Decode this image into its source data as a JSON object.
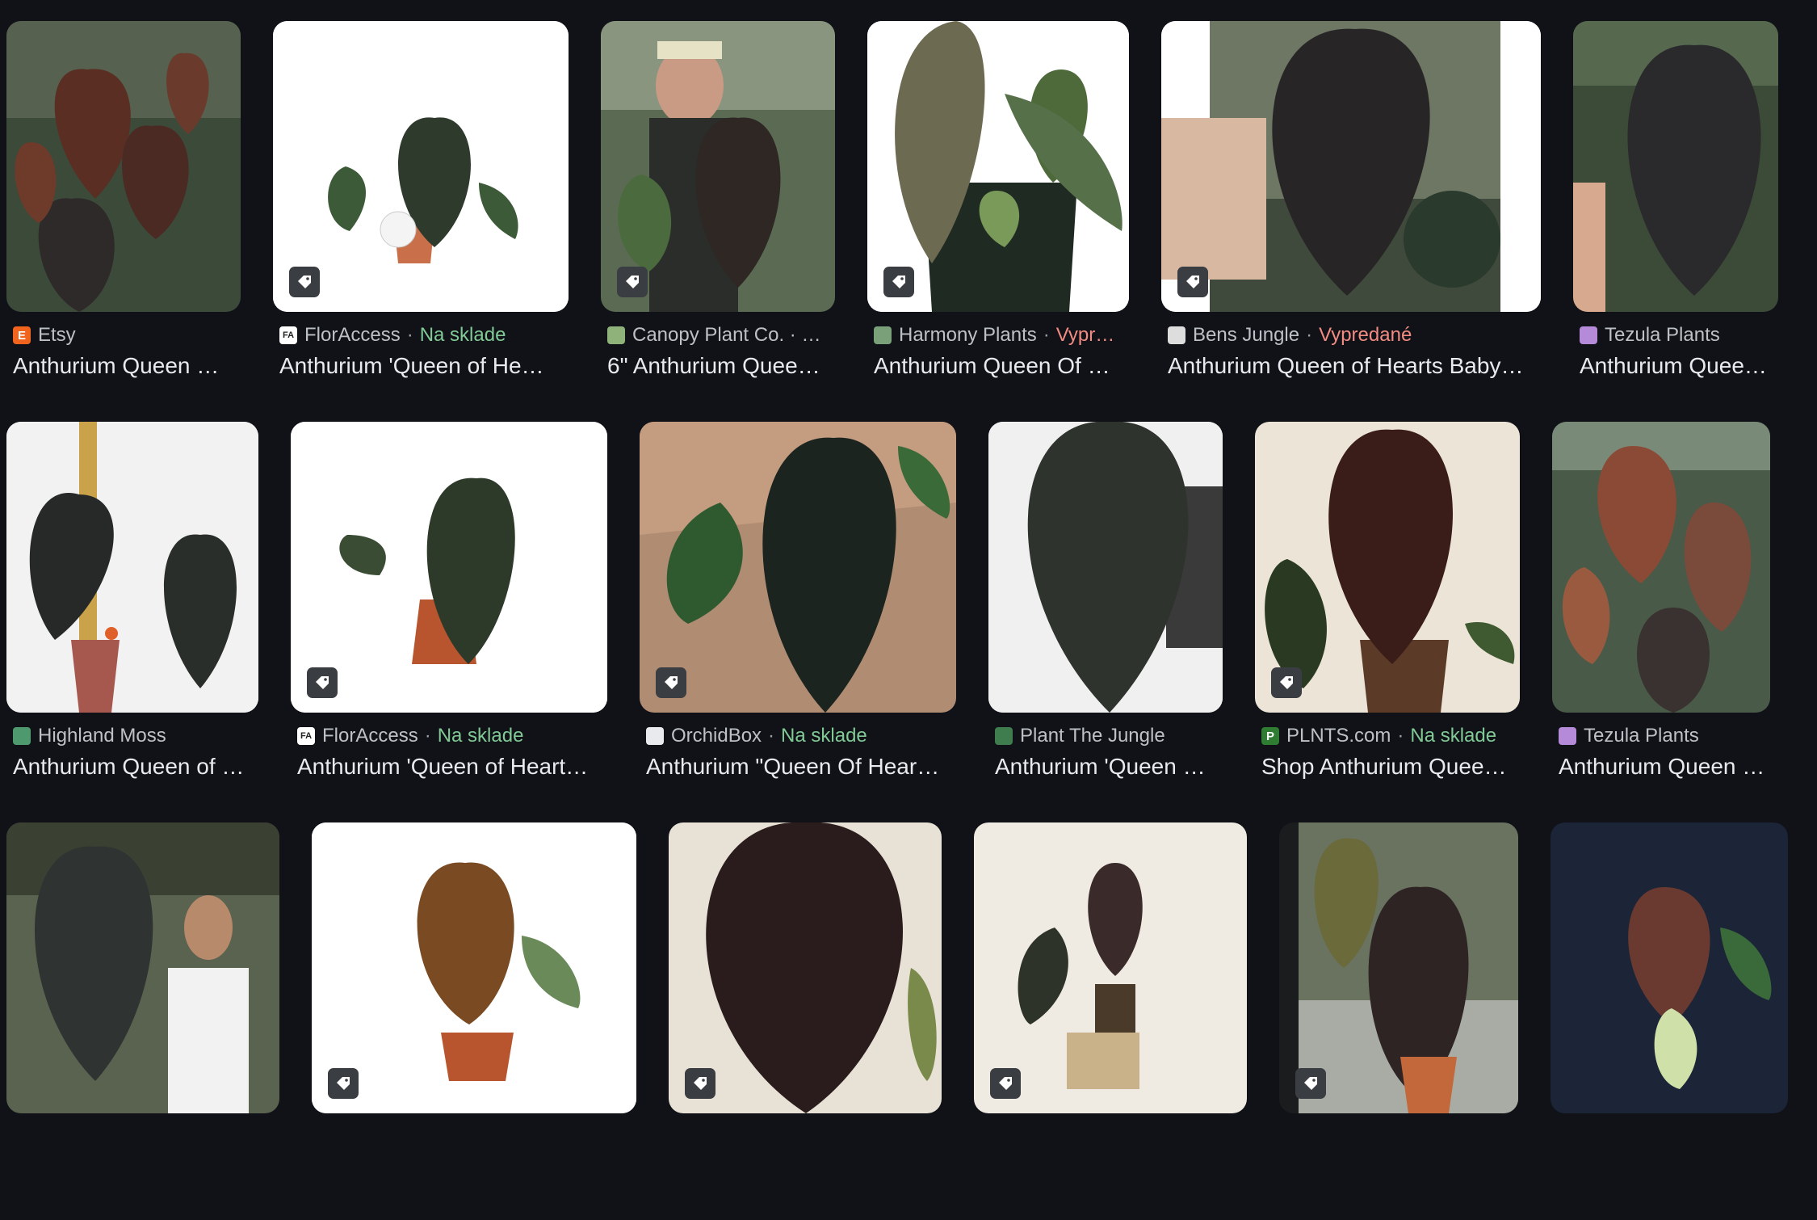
{
  "results": {
    "row1": [
      {
        "source": "Etsy",
        "status": "",
        "status_type": "",
        "title": "Anthurium Queen …",
        "favicon_icon": "etsy-favicon-icon",
        "favicon_color": "#f1641e",
        "favicon_glyph": "E"
      },
      {
        "source": "FlorAccess",
        "status": "Na sklade",
        "status_type": "stock",
        "title": "Anthurium 'Queen of He…",
        "favicon_icon": "floraccess-favicon-icon",
        "favicon_color": "#ffffff",
        "favicon_glyph": "FA"
      },
      {
        "source": "Canopy Plant Co. · …",
        "status": "",
        "status_type": "",
        "title": "6\" Anthurium Quee…",
        "favicon_icon": "canopy-favicon-icon",
        "favicon_color": "#8fb27a",
        "favicon_glyph": ""
      },
      {
        "source": "Harmony Plants",
        "status": "Vypr…",
        "status_type": "sold",
        "title": "Anthurium Queen Of …",
        "favicon_icon": "harmony-favicon-icon",
        "favicon_color": "#7aa07a",
        "favicon_glyph": ""
      },
      {
        "source": "Bens Jungle",
        "status": "Vypredané",
        "status_type": "sold",
        "title": "Anthurium Queen of Hearts Baby…",
        "favicon_icon": "bens-jungle-favicon-icon",
        "favicon_color": "#dddddd",
        "favicon_glyph": ""
      },
      {
        "source": "Tezula Plants",
        "status": "",
        "status_type": "",
        "title": "Anthurium Queen …",
        "favicon_icon": "tezula-favicon-icon",
        "favicon_color": "#b58ad8",
        "favicon_glyph": ""
      }
    ],
    "row2": [
      {
        "source": "Highland Moss",
        "status": "",
        "status_type": "",
        "title": "Anthurium Queen of …",
        "favicon_icon": "highland-moss-favicon-icon",
        "favicon_color": "#4e9a6e",
        "favicon_glyph": ""
      },
      {
        "source": "FlorAccess",
        "status": "Na sklade",
        "status_type": "stock",
        "title": "Anthurium 'Queen of Heart…",
        "favicon_icon": "floraccess-favicon-icon",
        "favicon_color": "#ffffff",
        "favicon_glyph": "FA"
      },
      {
        "source": "OrchidBox",
        "status": "Na sklade",
        "status_type": "stock",
        "title": "Anthurium \"Queen Of Hear…",
        "favicon_icon": "orchidbox-favicon-icon",
        "favicon_color": "#e8eaed",
        "favicon_glyph": ""
      },
      {
        "source": "Plant The Jungle",
        "status": "",
        "status_type": "",
        "title": "Anthurium 'Queen …",
        "favicon_icon": "plant-the-jungle-favicon-icon",
        "favicon_color": "#3f7d4f",
        "favicon_glyph": ""
      },
      {
        "source": "PLNTS.com",
        "status": "Na sklade",
        "status_type": "stock",
        "title": "Shop Anthurium Quee…",
        "favicon_icon": "plnts-favicon-icon",
        "favicon_color": "#2e7d32",
        "favicon_glyph": "P"
      },
      {
        "source": "Tezula Plants",
        "status": "",
        "status_type": "",
        "title": "Anthurium Queen Of…",
        "favicon_icon": "tezula-favicon-icon",
        "favicon_color": "#b58ad8",
        "favicon_glyph": ""
      }
    ],
    "row3": [
      {
        "title": ""
      },
      {
        "title": ""
      },
      {
        "title": ""
      },
      {
        "title": ""
      },
      {
        "title": ""
      },
      {
        "title": ""
      }
    ]
  }
}
